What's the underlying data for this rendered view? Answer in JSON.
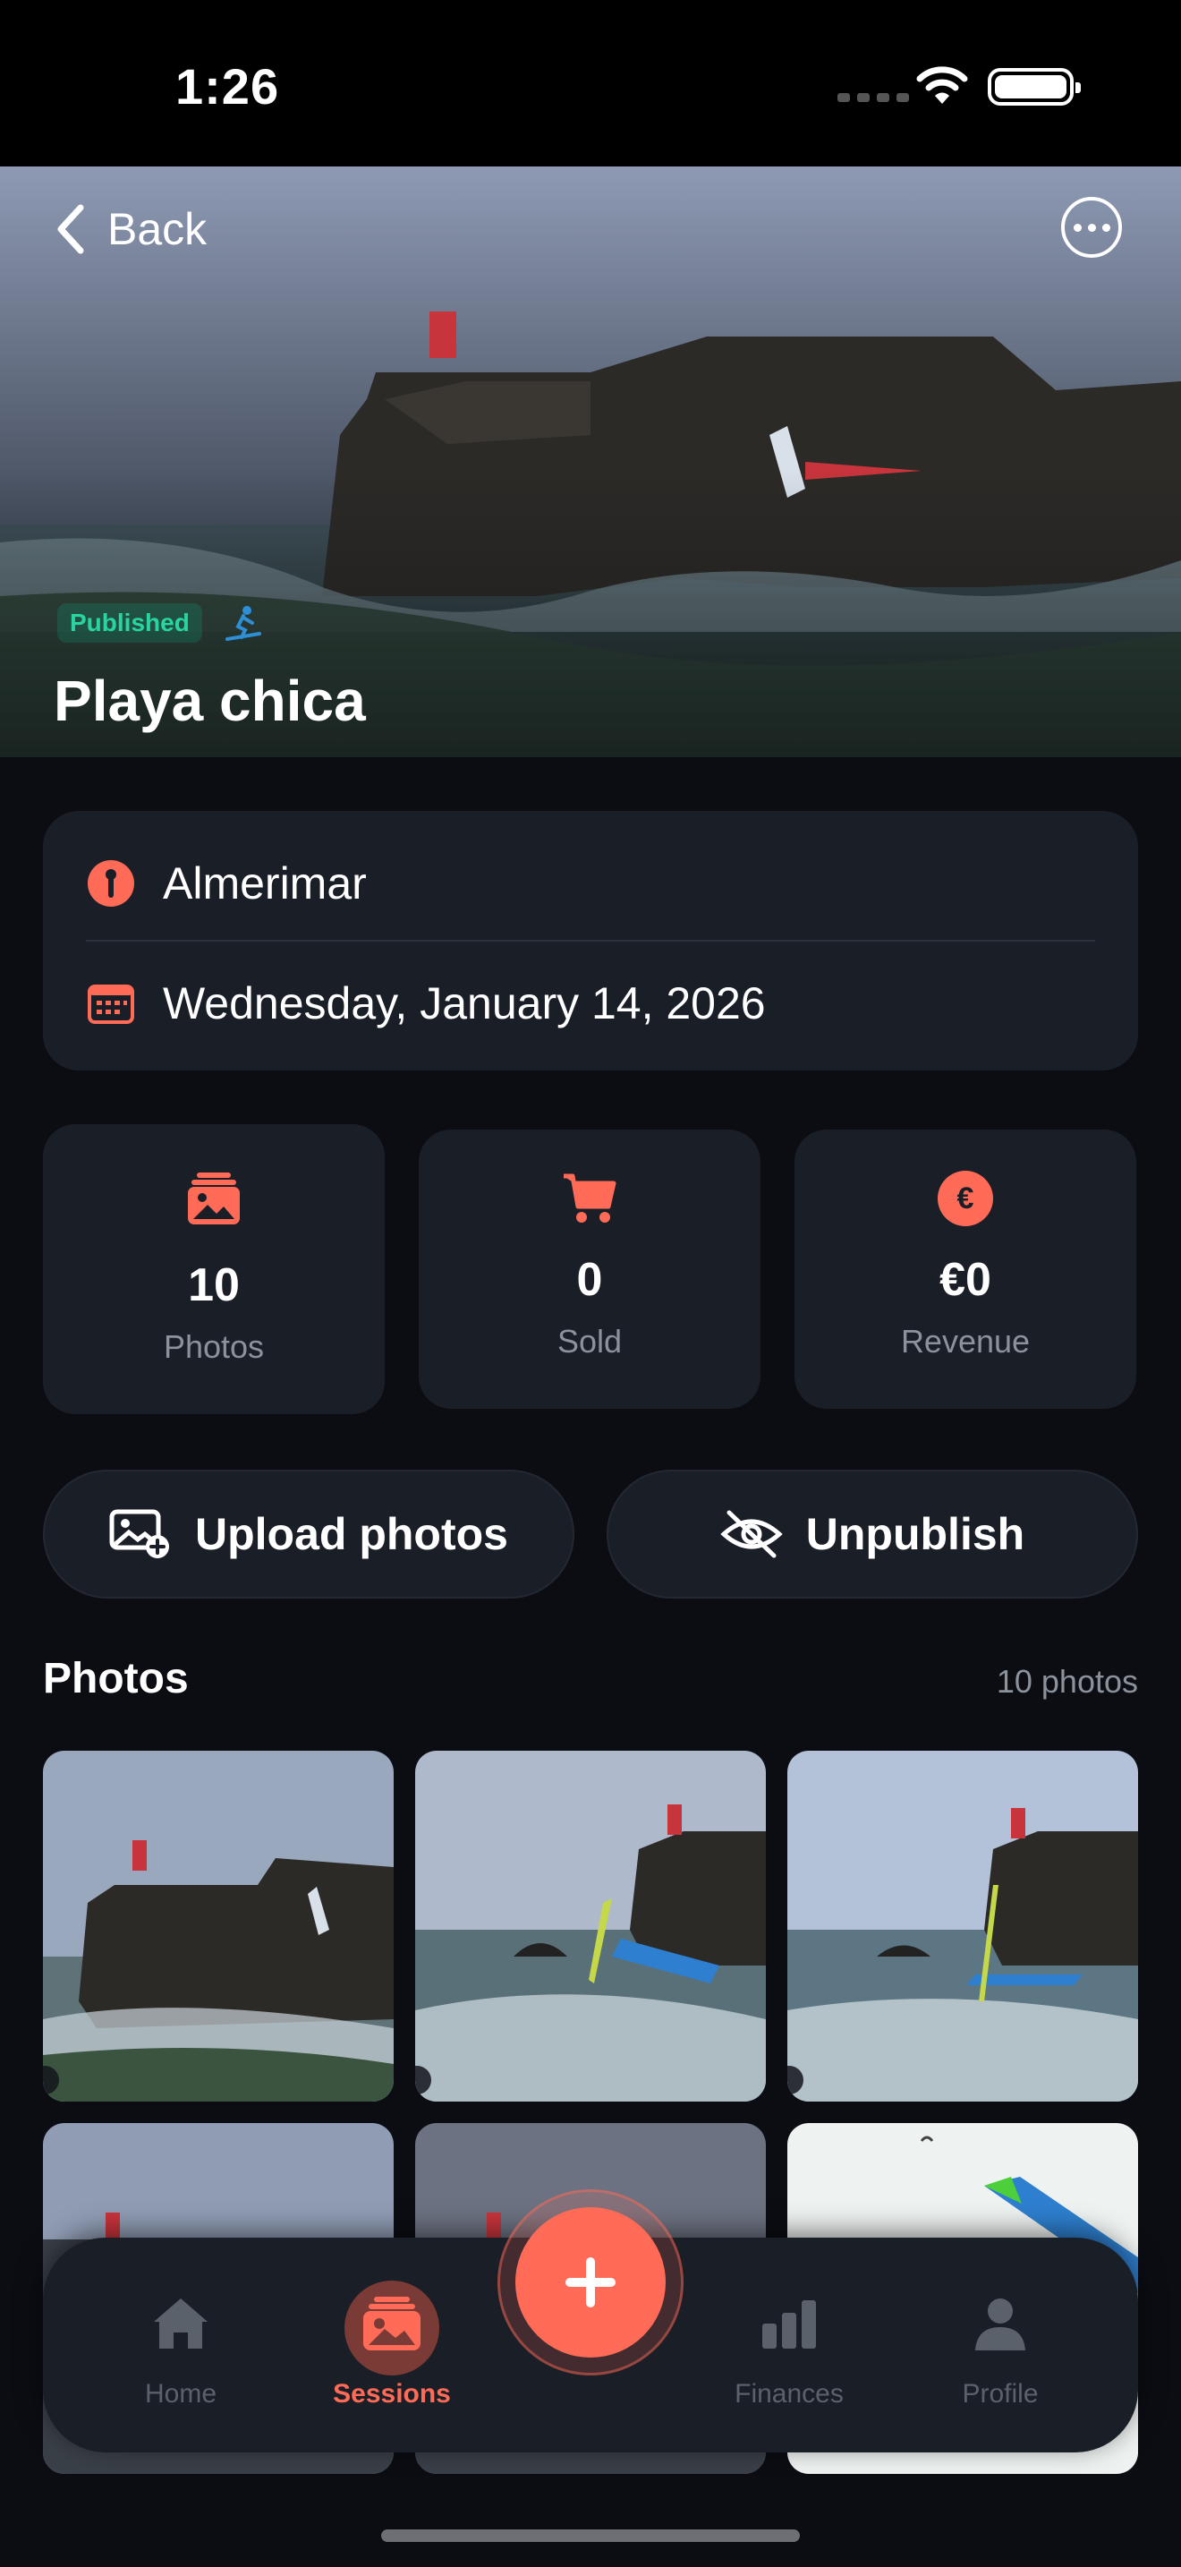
{
  "status_bar": {
    "time": "1:26"
  },
  "hero": {
    "back_label": "Back",
    "status_badge": "Published",
    "title": "Playa chica"
  },
  "info": {
    "location": "Almerimar",
    "date": "Wednesday, January 14, 2026"
  },
  "stats": [
    {
      "value": "10",
      "label": "Photos",
      "icon": "photos-icon"
    },
    {
      "value": "0",
      "label": "Sold",
      "icon": "cart-icon"
    },
    {
      "value": "€0",
      "label": "Revenue",
      "icon": "euro-icon",
      "icon_glyph": "€"
    }
  ],
  "actions": {
    "upload_label": "Upload photos",
    "unpublish_label": "Unpublish"
  },
  "photos_section": {
    "title": "Photos",
    "count": "10 photos"
  },
  "tabbar": {
    "items": [
      {
        "label": "Home",
        "icon": "home-icon",
        "active": false
      },
      {
        "label": "Sessions",
        "icon": "sessions-icon",
        "active": true
      },
      {
        "label": "Finances",
        "icon": "bar-chart-icon",
        "active": false
      },
      {
        "label": "Profile",
        "icon": "person-icon",
        "active": false
      }
    ]
  },
  "colors": {
    "accent": "#ff6b57",
    "card": "#1a1e26",
    "background": "#0b0d13",
    "published_badge": "#2ad4a0"
  }
}
